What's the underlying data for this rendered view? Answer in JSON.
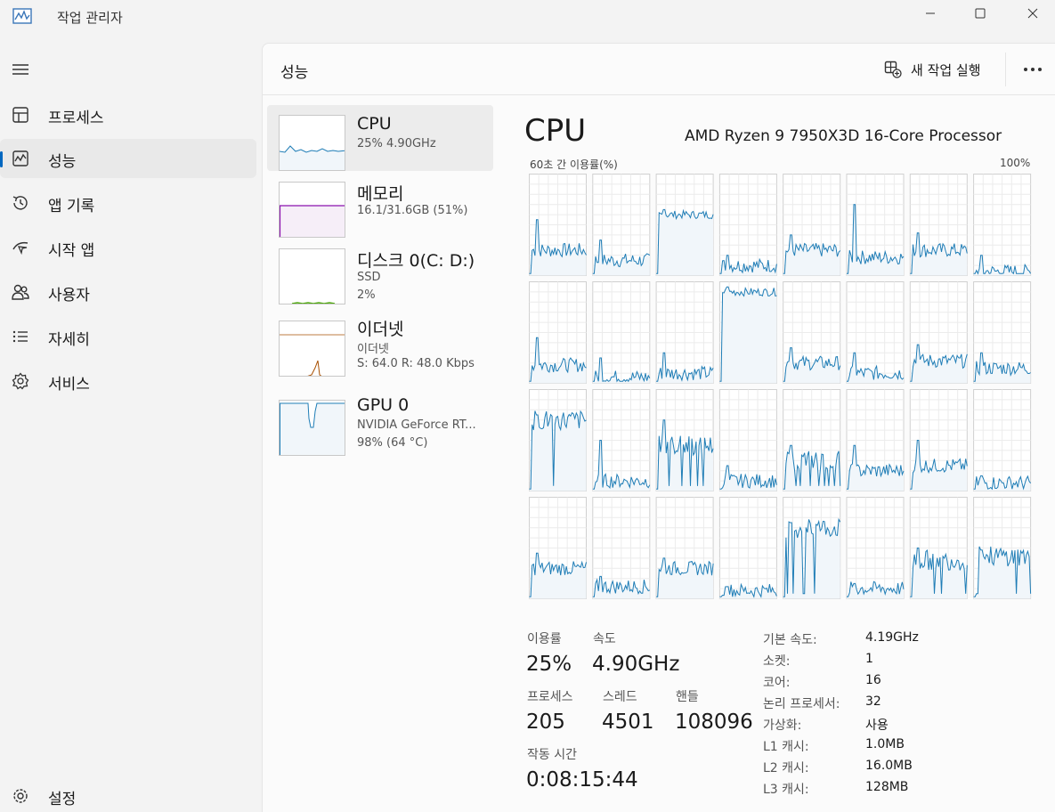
{
  "app": {
    "title": "작업 관리자"
  },
  "sidebar": {
    "items": [
      {
        "label": "프로세스",
        "icon": "processes-icon"
      },
      {
        "label": "성능",
        "icon": "performance-icon",
        "active": true
      },
      {
        "label": "앱 기록",
        "icon": "app-history-icon"
      },
      {
        "label": "시작 앱",
        "icon": "startup-apps-icon"
      },
      {
        "label": "사용자",
        "icon": "users-icon"
      },
      {
        "label": "자세히",
        "icon": "details-icon"
      },
      {
        "label": "서비스",
        "icon": "services-icon"
      }
    ],
    "settings_label": "설정"
  },
  "header": {
    "title": "성능",
    "run_new_task": "새 작업 실행"
  },
  "resources": [
    {
      "name": "CPU",
      "lines": [
        "25% 4.90GHz"
      ]
    },
    {
      "name": "메모리",
      "lines": [
        "16.1/31.6GB (51%)"
      ]
    },
    {
      "name": "디스크 0(C: D:)",
      "lines": [
        "SSD",
        "2%"
      ]
    },
    {
      "name": "이더넷",
      "lines": [
        "이더넷",
        "S: 64.0 R: 48.0 Kbps"
      ]
    },
    {
      "name": "GPU 0",
      "lines": [
        "NVIDIA GeForce RT...",
        "98% (64 °C)"
      ]
    }
  ],
  "cpu": {
    "title": "CPU",
    "model": "AMD Ryzen 9 7950X3D 16-Core Processor",
    "graph_caption": "60초 간 이용률(%)",
    "graph_max": "100%",
    "stats": {
      "utilization_label": "이용률",
      "utilization": "25%",
      "speed_label": "속도",
      "speed": "4.90GHz",
      "processes_label": "프로세스",
      "processes": "205",
      "threads_label": "스레드",
      "threads": "4501",
      "handles_label": "핸들",
      "handles": "108096",
      "uptime_label": "작동 시간",
      "uptime": "0:08:15:44"
    },
    "specs": [
      {
        "label": "기본 속도:",
        "value": "4.19GHz"
      },
      {
        "label": "소켓:",
        "value": "1"
      },
      {
        "label": "코어:",
        "value": "16"
      },
      {
        "label": "논리 프로세서:",
        "value": "32"
      },
      {
        "label": "가상화:",
        "value": "사용"
      },
      {
        "label": "L1 캐시:",
        "value": "1.0MB"
      },
      {
        "label": "L2 캐시:",
        "value": "16.0MB"
      },
      {
        "label": "L3 캐시:",
        "value": "128MB"
      }
    ]
  },
  "colors": {
    "accent": "#0067c0",
    "cpu_line": "#1f7db6",
    "cpu_fill": "#f1f6fa",
    "memory_line": "#8b12ae",
    "disk_line": "#4da60c",
    "ethernet_line": "#a74f01"
  }
}
